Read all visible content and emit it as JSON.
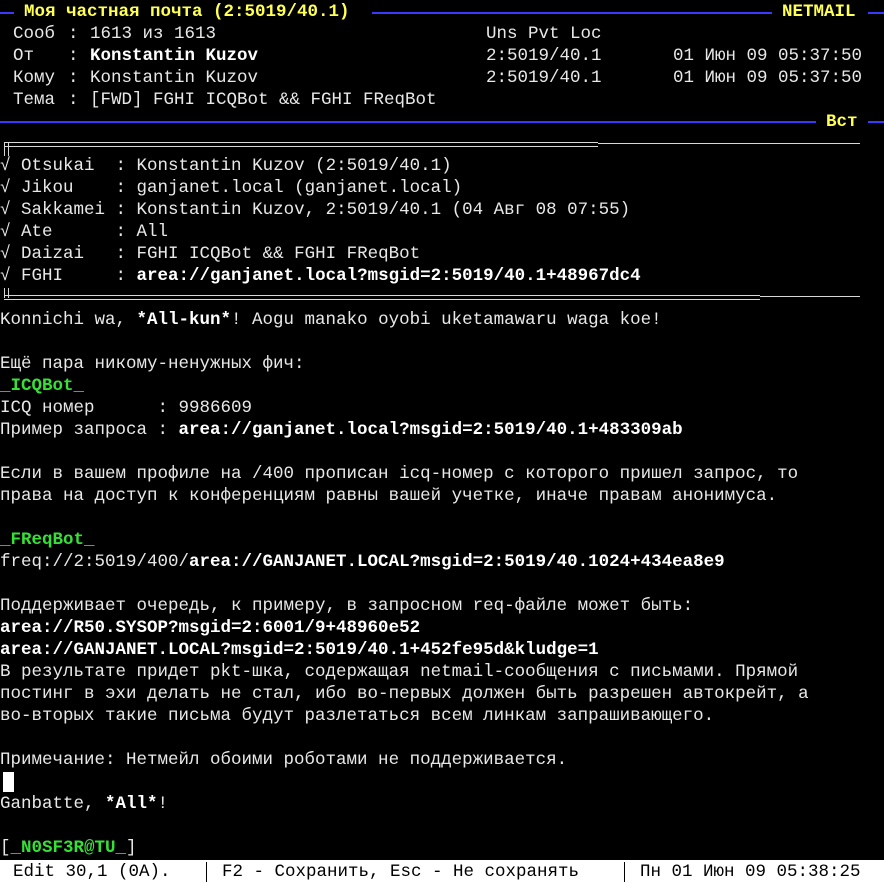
{
  "header": {
    "title": "Моя частная почта (2:5019/40.1)",
    "area": "NETMAIL",
    "msg_label": "Сооб",
    "msg_value": "1613 из 1613",
    "flags": "Uns Pvt Loc",
    "from_label": "От",
    "from_name": "Konstantin Kuzov",
    "from_addr": "2:5019/40.1",
    "from_date": "01 Июн 09 05:37:50",
    "to_label": "Кому",
    "to_name": "Konstantin Kuzov",
    "to_addr": "2:5019/40.1",
    "to_date": "01 Июн 09 05:37:50",
    "subj_label": "Тема",
    "subj_value": "[FWD] FGHI ICQBot && FGHI FReqBot",
    "mode": "Вст"
  },
  "kludges": [
    {
      "key": "√ Otsukai  :",
      "value": "Konstantin Kuzov (2:5019/40.1)",
      "bold": false
    },
    {
      "key": "√ Jikou    :",
      "value": "ganjanet.local (ganjanet.local)",
      "bold": false
    },
    {
      "key": "√ Sakkamei :",
      "value": "Konstantin Kuzov, 2:5019/40.1 (04 Авг 08 07:55)",
      "bold": false
    },
    {
      "key": "√ Ate      :",
      "value": "All",
      "bold": false
    },
    {
      "key": "√ Daizai   :",
      "value": "FGHI ICQBot && FGHI FReqBot",
      "bold": false
    },
    {
      "key": "√ FGHI     :",
      "value": "area://ganjanet.local?msgid=2:5019/40.1+48967dc4",
      "bold": true
    }
  ],
  "body": {
    "greet_a": "Konnichi wa, ",
    "greet_b": "*All-kun*",
    "greet_c": "! Aogu manako oyobi uketamawaru waga koe!",
    "intro": "Ещё пара никому-ненужных фич:",
    "icq_title": "_ICQBot_",
    "icq_num_label": "ICQ номер      : ",
    "icq_num": "9986609",
    "icq_req_label": "Пример запроса : ",
    "icq_req": "area://ganjanet.local?msgid=2:5019/40.1+483309ab",
    "icq_desc_1": "Если в вашем профиле на /400 прописан icq-номер с которого пришел запрос, то",
    "icq_desc_2": "права на доступ к конференциям равны вашей учетке, иначе правам анонимуса.",
    "freq_title": "_FReqBot_",
    "freq_prefix": "freq://2:5019/400/",
    "freq_link": "area://GANJANET.LOCAL?msgid=2:5019/40.1024+434ea8e9",
    "queue_text": "Поддерживает очередь, к примеру, в запросном req-файле может быть:",
    "queue_1": "area://R50.SYSOP?msgid=2:6001/9+48960e52",
    "queue_2": "area://GANJANET.LOCAL?msgid=2:5019/40.1+452fe95d&kludge=1",
    "result_1": "В результате придет pkt-шка, содержащая netmail-сообщения с письмами. Прямой",
    "result_2": "постинг в эхи делать не стал, ибо во-первых должен быть разрешен автокрейт, а",
    "result_3": "во-вторых такие письма будут разлетаться всем линкам запрашивающего.",
    "note": "Примечание: Нетмейл обоими роботами не поддерживается.",
    "bye_a": "Ganbatte, ",
    "bye_b": "*All*",
    "bye_c": "!",
    "sig_open": "[",
    "sig": "_N0SF3R@TU_",
    "sig_close": "]"
  },
  "status": {
    "mode": "Edit 30,1 (0A).",
    "keys": "F2 - Сохранить, Esc - Не сохранять",
    "clock": "Пн 01 Июн 09 05:38:25"
  },
  "colors": {
    "background": "#000000",
    "rule": "#3a3aff",
    "title": "#ffff54",
    "origin": "#36e036"
  }
}
